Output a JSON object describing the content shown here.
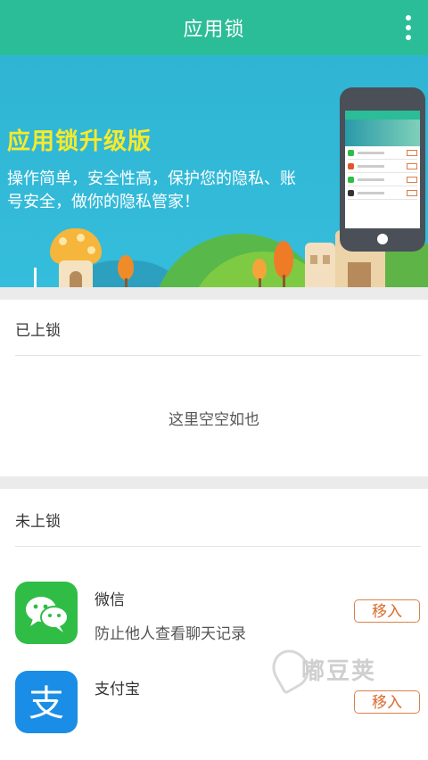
{
  "header": {
    "title": "应用锁",
    "menu_icon": "more-vertical-icon"
  },
  "banner": {
    "headline": "应用锁升级版",
    "description": "操作简单，安全性高，保护您的隐私、账号安全，做你的隐私管家！"
  },
  "locked_section": {
    "title": "已上锁",
    "empty_text": "这里空空如也"
  },
  "unlocked_section": {
    "title": "未上锁",
    "apps": [
      {
        "name": "微信",
        "description": "防止他人查看聊天记录",
        "icon": "wechat-icon",
        "action": "移入"
      },
      {
        "name": "支付宝",
        "description": "",
        "icon": "alipay-icon",
        "action": "移入"
      }
    ]
  },
  "watermark": {
    "text": "嘟豆荚"
  },
  "colors": {
    "accent": "#2bbd97",
    "banner": "#35bddc",
    "headline": "#f7ea2b",
    "move_button": "#d86a2c",
    "wechat": "#2fbd46",
    "alipay": "#1a8ee6"
  }
}
